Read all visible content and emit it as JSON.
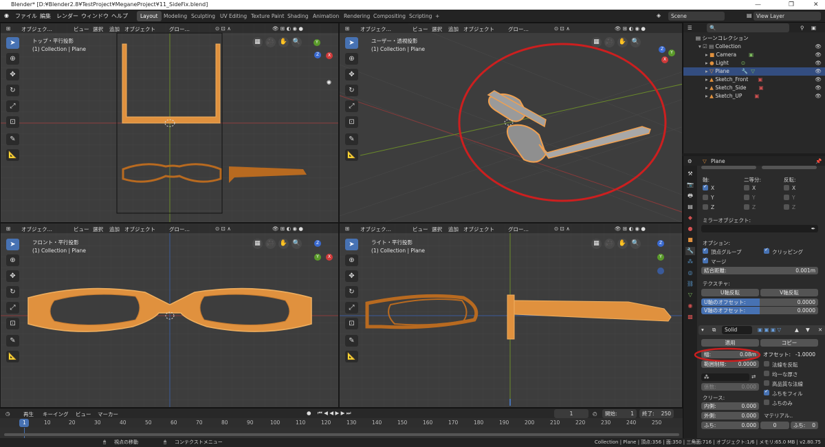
{
  "window": {
    "title": "Blender* [D:¥Blender2.8¥TestProject¥MeganeProject¥11_SideFix.blend]"
  },
  "menu": [
    "ファイル",
    "編集",
    "レンダー",
    "ウィンドウ",
    "ヘルプ"
  ],
  "workspaces": [
    "Layout",
    "Modeling",
    "Sculpting",
    "UV Editing",
    "Texture Paint",
    "Shading",
    "Animation",
    "Rendering",
    "Compositing",
    "Scripting",
    "+"
  ],
  "scene": "Scene",
  "view_layer": "View Layer",
  "vp_menu": {
    "mode": "オブジェク…",
    "view": "ビュー",
    "select": "選択",
    "add": "追加",
    "object": "オブジェクト",
    "orient": "グロー…"
  },
  "viewports": [
    {
      "view": "トップ・平行投影",
      "coll": "(1) Collection | Plane"
    },
    {
      "view": "ユーザー・透視投影",
      "coll": "(1) Collection | Plane"
    },
    {
      "view": "フロント・平行投影",
      "coll": "(1) Collection | Plane"
    },
    {
      "view": "ライト・平行投影",
      "coll": "(1) Collection | Plane"
    }
  ],
  "outliner": {
    "root": "シーンコレクション",
    "items": [
      "Collection",
      "Camera",
      "Light",
      "Plane",
      "Sketch_Front",
      "Sketch_Side",
      "Sketch_UP"
    ]
  },
  "props": {
    "object": "Plane",
    "axis": "軸:",
    "bisect": "二等分:",
    "flip": "反転:",
    "x": "X",
    "y": "Y",
    "z": "Z",
    "mirror_obj": "ミラーオブジェクト:",
    "options": "オプション:",
    "vgroups": "頂点グループ",
    "clipping": "クリッピング",
    "merge": "マージ",
    "merge_dist_label": "結合距離:",
    "merge_dist": "0.001m",
    "texture": "テクスチャ:",
    "u_flip": "U軸反転",
    "v_flip": "V軸反転",
    "u_offset_label": "U軸のオフセット:",
    "u_offset": "0.0000",
    "v_offset_label": "V軸のオフセット:",
    "v_offset": "0.0000",
    "solid": "Solid",
    "apply": "適用",
    "copy": "コピー",
    "width_label": "幅:",
    "width": "0.08m",
    "offset_label": "オフセット:",
    "offset": "-1.0000",
    "clamp_label": "範囲制限:",
    "clamp": "0.0000",
    "flip_normals": "法線を反転",
    "even": "均一な厚さ",
    "hq_normals": "高品質な法線",
    "fill_rim": "ふちをフィル",
    "rim_only": "ふちのみ",
    "factor_label": "係数:",
    "factor": "0.000",
    "crease": "クリース:",
    "inner_label": "内側:",
    "inner": "0.000",
    "outer_label": "外側:",
    "outer": "0.000",
    "rim_label": "ふち:",
    "rim": "0.000",
    "material": "マテリアル..",
    "mat1": "0",
    "mat_rim_label": "ふち:",
    "mat2": "0"
  },
  "timeline": {
    "playback": "再生",
    "keying": "キーイング",
    "view": "ビュー",
    "marker": "マーカー",
    "current": "1",
    "start_label": "開始:",
    "start": "1",
    "end_label": "終了:",
    "end": "250",
    "ticks": [
      "1",
      "10",
      "20",
      "30",
      "40",
      "50",
      "60",
      "70",
      "80",
      "90",
      "100",
      "110",
      "120",
      "130",
      "140",
      "150",
      "160",
      "170",
      "180",
      "190",
      "200",
      "210",
      "220",
      "230",
      "240",
      "250"
    ]
  },
  "status": {
    "nav": "視点の移動",
    "ctx": "コンテクストメニュー",
    "info": "Collection | Plane | 頂点:356 | 面:350 | 三角面:716 | オブジェクト:1/6 | メモリ:65.0 MB | v2.80.75"
  }
}
